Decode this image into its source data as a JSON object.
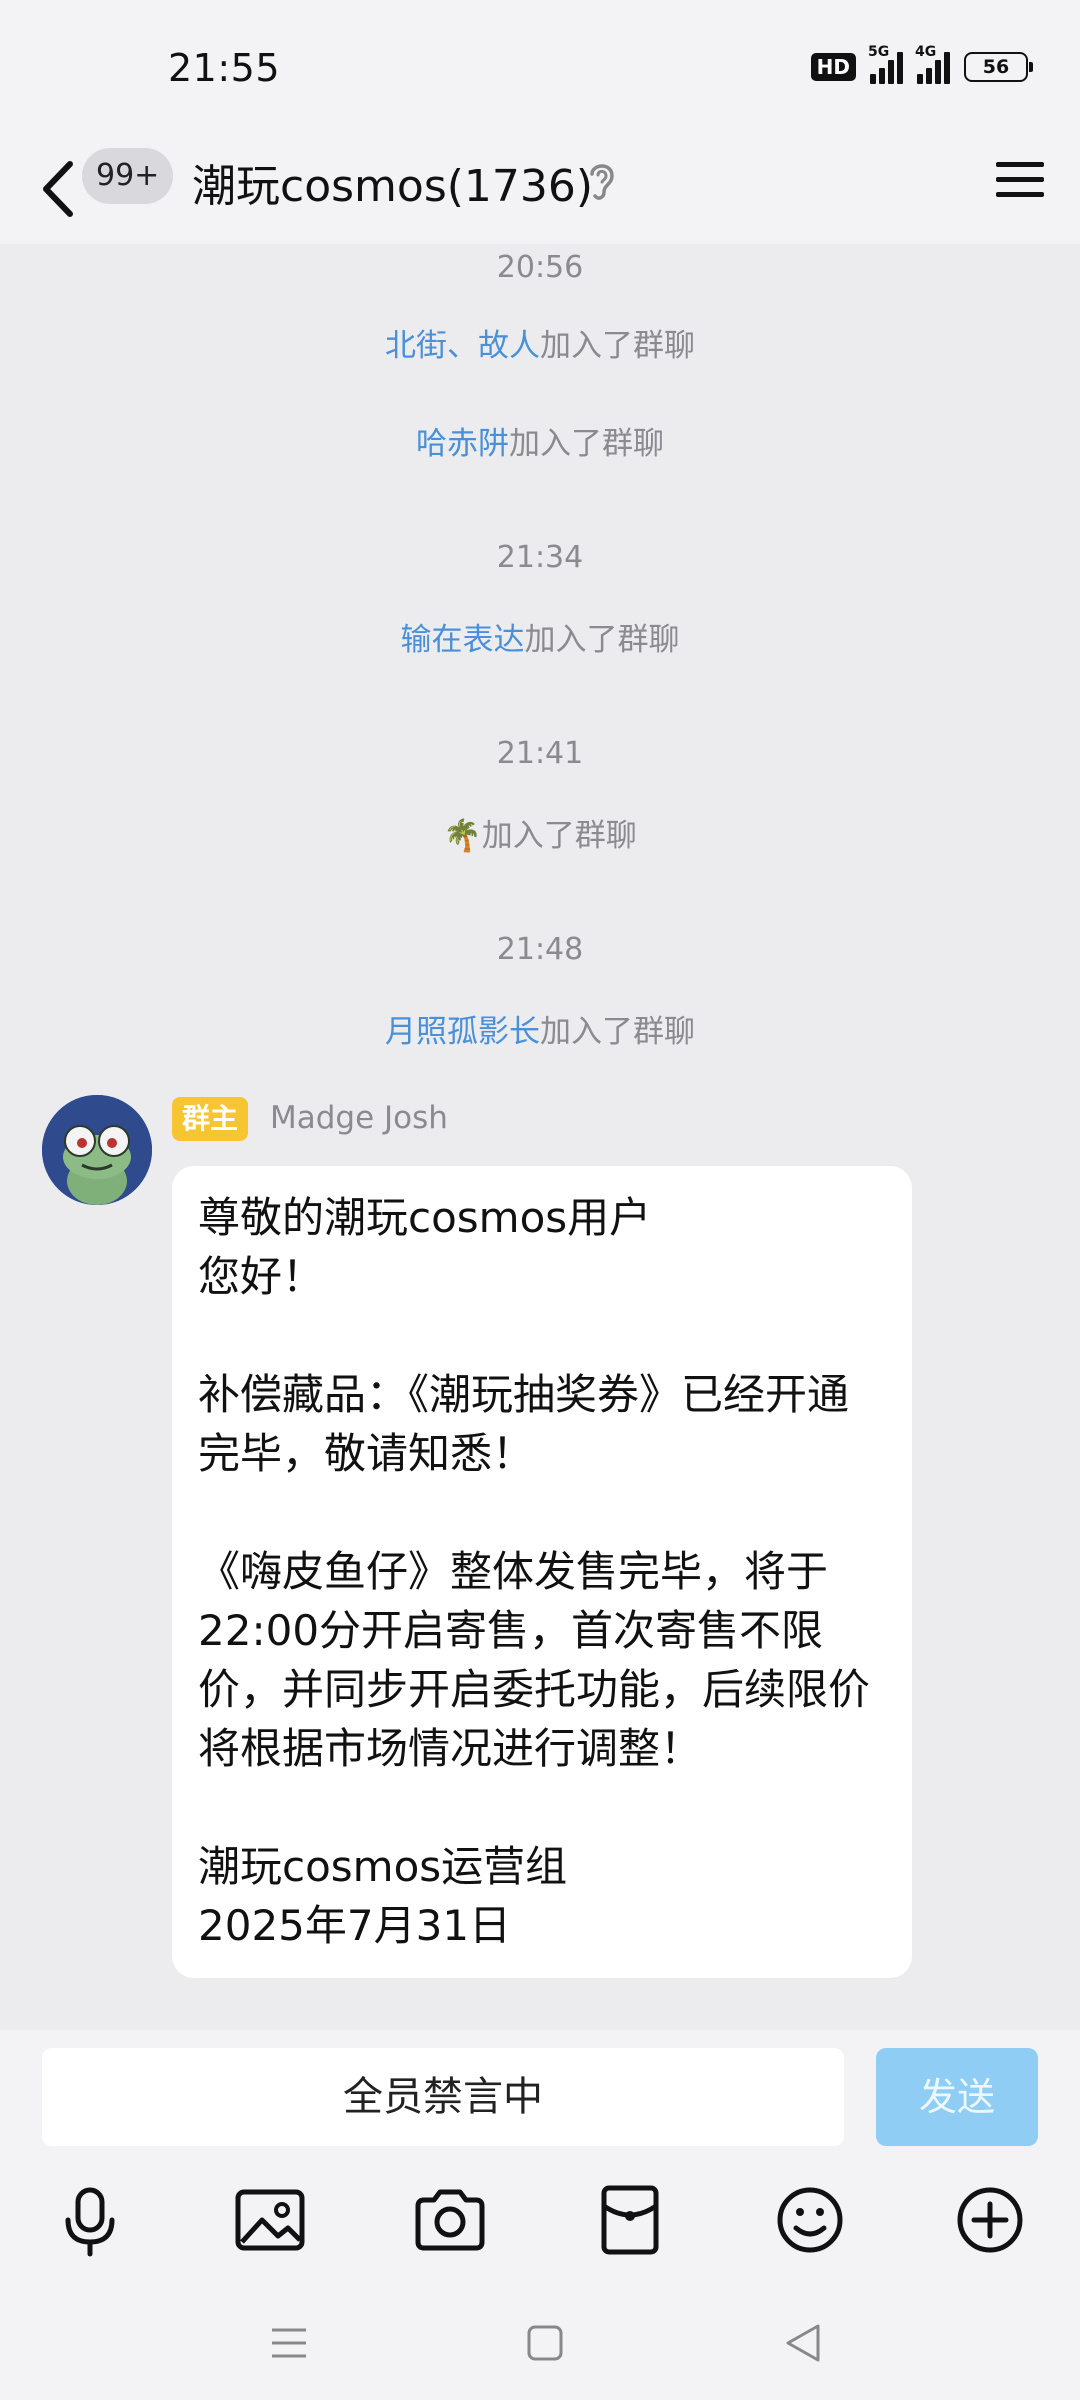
{
  "status_bar": {
    "time": "21:55",
    "hd_label": "HD",
    "network1": "5G",
    "network2": "4G",
    "battery": "56"
  },
  "nav": {
    "unread_badge": "99+",
    "title": "潮玩cosmos(1736)"
  },
  "messages": {
    "ts1": "20:56",
    "join1_name": "北街、故人",
    "join1_text": "加入了群聊",
    "join2_name": "哈赤阱",
    "join2_text": "加入了群聊",
    "ts2": "21:34",
    "join3_name": "输在表达",
    "join3_text": "加入了群聊",
    "ts3": "21:41",
    "join4_name": "🌴",
    "join4_text": "加入了群聊",
    "ts4": "21:48",
    "join5_name": "月照孤影长",
    "join5_text": "加入了群聊"
  },
  "announcement": {
    "role": "群主",
    "sender": "Madge Josh",
    "body": "尊敬的潮玩cosmos用户\n您好！\n\n补偿藏品：《潮玩抽奖券》已经开通完毕，敬请知悉！\n\n《嗨皮鱼仔》整体发售完毕，将于22:00分开启寄售，首次寄售不限价，并同步开启委托功能，后续限价将根据市场情况进行调整！\n\n潮玩cosmos运营组\n2025年7月31日"
  },
  "input": {
    "muted_text": "全员禁言中",
    "send_label": "发送"
  },
  "colors": {
    "link": "#4a90d9",
    "role_badge": "#f7c531",
    "send_button": "#8fcdf5"
  },
  "icons": [
    "microphone-icon",
    "image-icon",
    "camera-icon",
    "red-packet-icon",
    "emoji-icon",
    "plus-icon"
  ]
}
